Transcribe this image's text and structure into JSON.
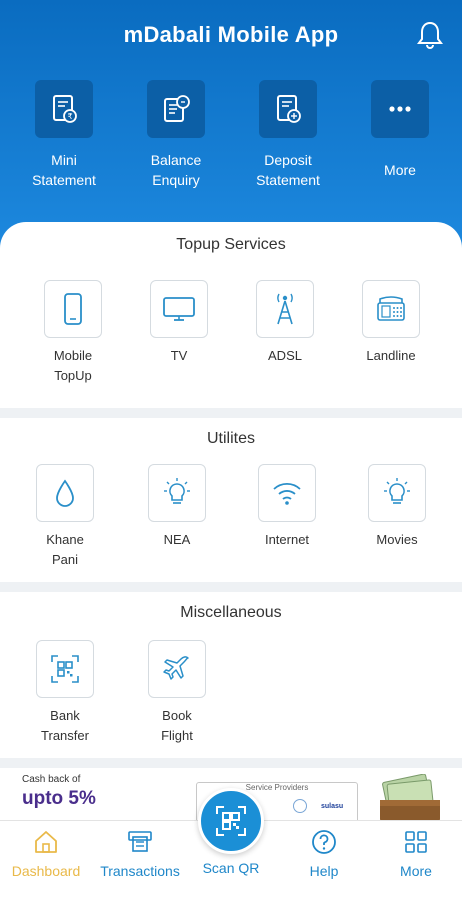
{
  "header": {
    "title": "mDabali Mobile App",
    "bell_icon": "bell-icon"
  },
  "quick": [
    {
      "label": "Mini\nStatement",
      "icon": "mini-statement-icon"
    },
    {
      "label": "Balance\nEnquiry",
      "icon": "balance-enquiry-icon"
    },
    {
      "label": "Deposit\nStatement",
      "icon": "deposit-statement-icon"
    },
    {
      "label": "More",
      "icon": "more-dots-icon"
    }
  ],
  "topup": {
    "title": "Topup Services",
    "items": [
      {
        "label": "Mobile\nTopUp",
        "icon": "mobile-icon"
      },
      {
        "label": "TV",
        "icon": "tv-icon"
      },
      {
        "label": "ADSL",
        "icon": "tower-icon"
      },
      {
        "label": "Landline",
        "icon": "landline-phone-icon"
      }
    ]
  },
  "utilities": {
    "title": "Utilites",
    "items": [
      {
        "label": "Khane\nPani",
        "icon": "water-drop-icon"
      },
      {
        "label": "NEA",
        "icon": "bulb-icon"
      },
      {
        "label": "Internet",
        "icon": "wifi-icon"
      },
      {
        "label": "Movies",
        "icon": "bulb-icon"
      }
    ]
  },
  "misc": {
    "title": "Miscellaneous",
    "items": [
      {
        "label": "Bank\nTransfer",
        "icon": "qr-transfer-icon"
      },
      {
        "label": "Book\nFlight",
        "icon": "airplane-icon"
      }
    ]
  },
  "banner": {
    "cashback_small": "Cash back of",
    "cashback_big": "upto 5%",
    "providers_title": "Service Providers",
    "provider_logo": "sulasu"
  },
  "tabbar": {
    "items": [
      {
        "label": "Dashboard",
        "icon": "home-icon",
        "active": true
      },
      {
        "label": "Transactions",
        "icon": "atm-icon",
        "active": false
      },
      {
        "label": "Help",
        "icon": "help-icon",
        "active": false
      },
      {
        "label": "More",
        "icon": "grid-icon",
        "active": false
      }
    ],
    "scan_label": "Scan QR"
  },
  "colors": {
    "header_blue": "#0a6cc0",
    "icon_blue": "#2a8fc9",
    "active_tab": "#e9b949",
    "cashback_purple": "#4a2e8c"
  }
}
